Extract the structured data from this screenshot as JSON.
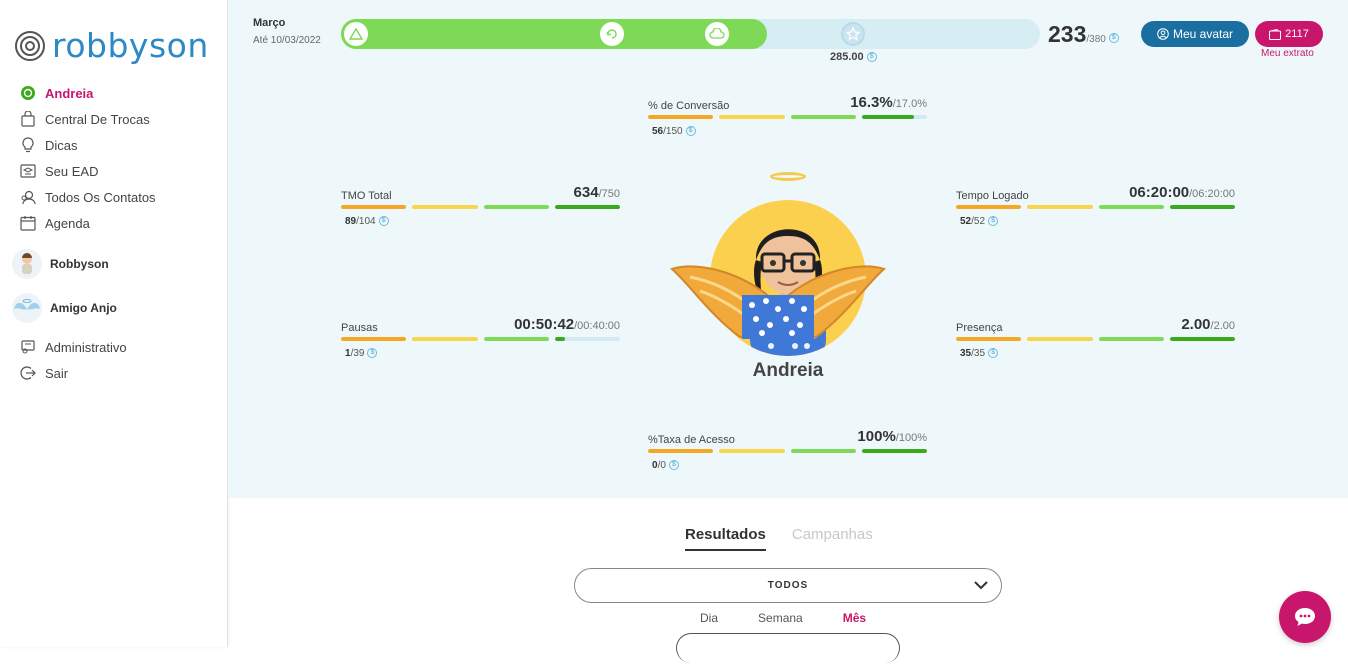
{
  "brand": {
    "logo_text": "robbyson"
  },
  "sidebar": {
    "items": [
      {
        "label": "Andreia",
        "icon": "user-circle-icon",
        "active": true
      },
      {
        "label": "Central De Trocas",
        "icon": "shopping-bag-icon"
      },
      {
        "label": "Dicas",
        "icon": "lightbulb-icon"
      },
      {
        "label": "Seu EAD",
        "icon": "graduation-icon"
      },
      {
        "label": "Todos Os Contatos",
        "icon": "contacts-icon"
      },
      {
        "label": "Agenda",
        "icon": "calendar-icon"
      }
    ],
    "people": [
      {
        "label": "Robbyson",
        "icon": "robbyson-avatar"
      },
      {
        "label": "Amigo Anjo",
        "icon": "angel-avatar"
      }
    ],
    "bottom_items": [
      {
        "label": "Administrativo",
        "icon": "admin-icon"
      },
      {
        "label": "Sair",
        "icon": "logout-icon"
      }
    ]
  },
  "header": {
    "month": "Março",
    "until": "Até 10/03/2022",
    "progress_fraction": 0.61,
    "goal_value": "285.00",
    "score": "233",
    "score_max": "/380",
    "avatar_button": "Meu avatar",
    "extrato_value": "2117",
    "extrato_label": "Meu extrato"
  },
  "colors": {
    "brand_pink": "#c8166d",
    "brand_blue": "#1a6fa0",
    "progress_green": "#7ed957",
    "seg_orange": "#f5a623",
    "seg_yellow": "#f8d54a",
    "seg_lightgreen": "#7ed957",
    "seg_green": "#3aaa1c"
  },
  "metrics": {
    "conversao": {
      "label": "% de Conversão",
      "value": "16.3%",
      "target": "/17.0%",
      "sub_value": "56",
      "sub_max": "/150",
      "fill": [
        1,
        1,
        1,
        0.8
      ]
    },
    "tmo": {
      "label": "TMO Total",
      "value": "634",
      "target": "/750",
      "sub_value": "89",
      "sub_max": "/104",
      "fill": [
        1,
        1,
        1,
        1
      ]
    },
    "tempo": {
      "label": "Tempo Logado",
      "value": "06:20:00",
      "target": "/06:20:00",
      "sub_value": "52",
      "sub_max": "/52",
      "fill": [
        1,
        1,
        1,
        1
      ]
    },
    "pausas": {
      "label": "Pausas",
      "value": "00:50:42",
      "target": "/00:40:00",
      "sub_value": "1",
      "sub_max": "/39",
      "fill": [
        1,
        1,
        1,
        0.15
      ]
    },
    "presenca": {
      "label": "Presença",
      "value": "2.00",
      "target": "/2.00",
      "sub_value": "35",
      "sub_max": "/35",
      "fill": [
        1,
        1,
        1,
        1
      ]
    },
    "acesso": {
      "label": "%Taxa de Acesso",
      "value": "100%",
      "target": "/100%",
      "sub_value": "0",
      "sub_max": "/0",
      "fill": [
        1,
        1,
        1,
        1
      ]
    }
  },
  "avatar": {
    "name": "Andreia"
  },
  "tabs": {
    "results": "Resultados",
    "campaigns": "Campanhas"
  },
  "filter": {
    "selected": "TODOS"
  },
  "periods": {
    "day": "Dia",
    "week": "Semana",
    "month": "Mês"
  }
}
